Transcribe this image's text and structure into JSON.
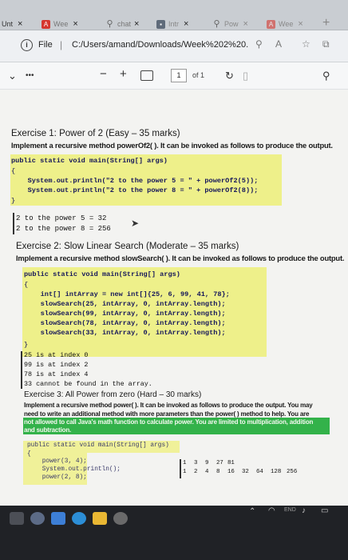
{
  "tabs": [
    {
      "label": "Unt",
      "close": "×"
    },
    {
      "label": "Wee",
      "close": "×"
    },
    {
      "label": "chat",
      "close": "×"
    },
    {
      "label": "Intr",
      "close": "×"
    },
    {
      "label": "Pow",
      "close": "×"
    },
    {
      "label": "Wee",
      "close": "×"
    }
  ],
  "new_tab": "+",
  "address": {
    "label": "File",
    "separator": "|",
    "path": "C:/Users/amand/Downloads/Week%202%20..."
  },
  "pdf_toolbar": {
    "more": "•••",
    "zoom_out": "−",
    "zoom_in": "+",
    "page": "1",
    "of": "of 1"
  },
  "exercise1": {
    "title": "Exercise 1: Power of 2 (Easy – 35 marks)",
    "desc": "Implement a recursive method powerOf2( ). It can be invoked as follows to produce the output.",
    "code": [
      "public static void main(String[] args)",
      "{",
      "    System.out.println(\"2 to the power 5 = \" + powerOf2(5));",
      "    System.out.println(\"2 to the power 8 = \" + powerOf2(8));",
      "}"
    ],
    "output": [
      "2 to the power 5 = 32",
      "2 to the power 8 = 256"
    ]
  },
  "exercise2": {
    "title": "Exercise 2: Slow Linear Search (Moderate – 35 marks)",
    "desc": "Implement a recursive method slowSearch( ). It can be invoked as follows to produce the output.",
    "code": [
      "public static void main(String[] args)",
      "{",
      "    int[] intArray = new int[]{25, 6, 99, 41, 78};",
      "    slowSearch(25, intArray, 0, intArray.length);",
      "    slowSearch(99, intArray, 0, intArray.length);",
      "    slowSearch(78, intArray, 0, intArray.length);",
      "    slowSearch(33, intArray, 0, intArray.length);",
      "}"
    ],
    "output": [
      "25 is at index 0",
      "99 is at index 2",
      "78 is at index 4",
      "33 cannot be found in the array."
    ]
  },
  "exercise3": {
    "title": "Exercise 3: All Power from zero (Hard – 30 marks)",
    "desc": [
      "Implement a recursive method power( ). It can be invoked as follows to produce the output. You may",
      "need to write an additional method with more parameters than the power( ) method to help. You are",
      "not allowed to call Java's math function to calculate power. You are limited to multiplication, addition",
      "and subtraction."
    ],
    "code": [
      "public static void main(String[] args)",
      "{",
      "    power(3, 4);",
      "    System.out.println();",
      "    power(2, 8);"
    ],
    "output_row1": [
      "1",
      "3",
      "9",
      "27",
      "81"
    ],
    "output_row2": [
      "1",
      "2",
      "4",
      "8",
      "16",
      "32",
      "64",
      "128",
      "256"
    ]
  },
  "taskbar": {
    "end_key": "END"
  }
}
